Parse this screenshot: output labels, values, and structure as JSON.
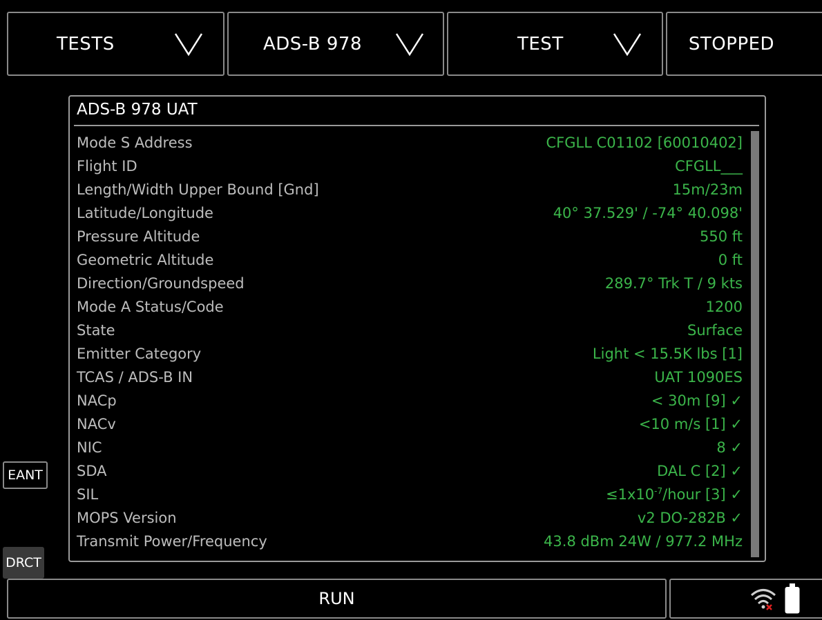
{
  "topbar": {
    "tests_label": "TESTS",
    "mode_label": "ADS-B 978",
    "test_label": "TEST",
    "state_label": "STOPPED"
  },
  "panel": {
    "title": "ADS-B 978 UAT",
    "rows": [
      {
        "label": "Mode S Address",
        "value": "CFGLL C01102 [60010402]"
      },
      {
        "label": "Flight ID",
        "value": "CFGLL___"
      },
      {
        "label": "Length/Width Upper Bound [Gnd]",
        "value": "15m/23m"
      },
      {
        "label": "Latitude/Longitude",
        "value": "40° 37.529' / -74° 40.098'"
      },
      {
        "label": "Pressure Altitude",
        "value": "550 ft"
      },
      {
        "label": "Geometric Altitude",
        "value": "0 ft"
      },
      {
        "label": "Direction/Groundspeed",
        "value": "289.7° Trk T / 9 kts"
      },
      {
        "label": "Mode A Status/Code",
        "value": "1200"
      },
      {
        "label": "State",
        "value": "Surface"
      },
      {
        "label": "Emitter Category",
        "value": "Light < 15.5K lbs [1]"
      },
      {
        "label": "TCAS / ADS-B IN",
        "value": "UAT 1090ES"
      },
      {
        "label": "NACp",
        "value": "< 30m [9] ✓"
      },
      {
        "label": "NACv",
        "value": "<10 m/s [1] ✓"
      },
      {
        "label": "NIC",
        "value": "8 ✓"
      },
      {
        "label": "SDA",
        "value": "DAL C [2] ✓"
      },
      {
        "label": "SIL",
        "value_prefix": "≤1x10",
        "value_exp": "-7",
        "value_suffix": "/hour [3] ✓"
      },
      {
        "label": "MOPS Version",
        "value": "v2 DO-282B ✓"
      },
      {
        "label": "Transmit Power/Frequency",
        "value": "43.8 dBm 24W / 977.2 MHz"
      }
    ]
  },
  "side": {
    "eant_label": "EANT",
    "drct_label": "DRCT"
  },
  "bottombar": {
    "run_label": "RUN",
    "icons": [
      "wifi-disconnected-icon",
      "battery-icon"
    ]
  },
  "colors": {
    "value_green": "#3bb54a",
    "label_gray": "#bdbdbd",
    "border_gray": "#8a8a8a"
  }
}
